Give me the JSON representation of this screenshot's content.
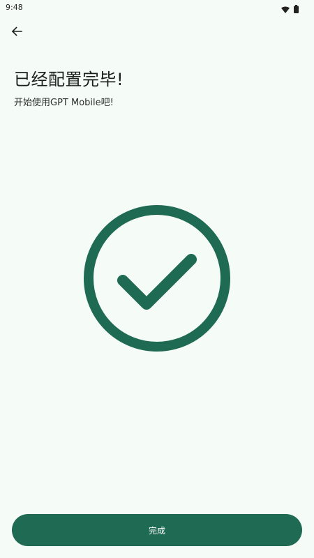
{
  "status_bar": {
    "time": "9:48",
    "wifi_icon": "wifi-icon",
    "battery_icon": "battery-icon"
  },
  "header": {
    "back_icon": "arrow-back-icon"
  },
  "main": {
    "title": "已经配置完毕!",
    "subtitle": "开始使用GPT Mobile吧!",
    "illustration_icon": "check-circle-icon",
    "accent_color": "#1e6a52"
  },
  "footer": {
    "done_label": "完成"
  }
}
